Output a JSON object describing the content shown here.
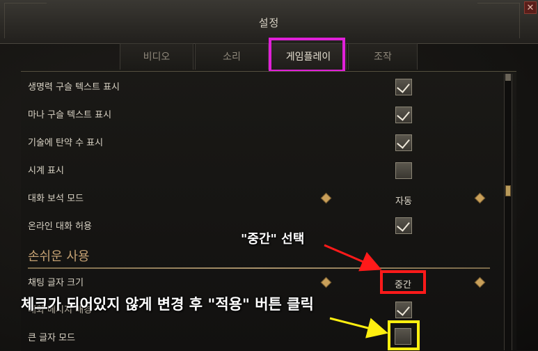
{
  "window": {
    "title": "설정"
  },
  "tabs": [
    {
      "label": "비디오"
    },
    {
      "label": "소리"
    },
    {
      "label": "게임플레이"
    },
    {
      "label": "조작"
    }
  ],
  "settings": [
    {
      "label": "생명력 구슬 텍스트 표시",
      "checked": true
    },
    {
      "label": "마나 구슬 텍스트 표시",
      "checked": true
    },
    {
      "label": "기술에 탄약 수 표시",
      "checked": true
    },
    {
      "label": "시계 표시",
      "checked": false
    },
    {
      "label": "대화 보석 모드",
      "value": "자동"
    },
    {
      "label": "온라인 대화 허용",
      "checked": true
    }
  ],
  "accessibility": {
    "section_title": "손쉬운 사용",
    "chat_font_size": {
      "label": "채팅 글자 크기",
      "value": "중간"
    },
    "hidden_row": {
      "label": "대화 메시지 배경",
      "checked": true
    },
    "large_font_mode": {
      "label": "큰 글자 모드",
      "checked": false
    }
  },
  "annotations": {
    "select_middle": "\"중간\" 선택",
    "uncheck_and_apply": "체크가 되어있지 않게 변경 후 \"적용\" 버튼 클릭"
  },
  "colors": {
    "tab_highlight": "#e020d8",
    "red_box": "#ff1a1a",
    "yellow_box": "#ffef10",
    "section_gold": "#c4a173"
  }
}
